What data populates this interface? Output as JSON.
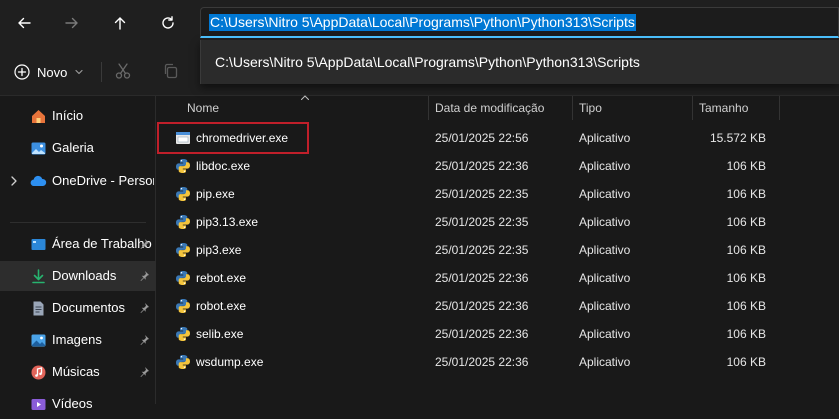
{
  "address": {
    "path": "C:\\Users\\Nitro 5\\AppData\\Local\\Programs\\Python\\Python313\\Scripts",
    "suggestion": "C:\\Users\\Nitro 5\\AppData\\Local\\Programs\\Python\\Python313\\Scripts"
  },
  "nav_buttons": {
    "back_icon": "arrow-left-icon",
    "forward_icon": "arrow-right-icon",
    "up_icon": "arrow-up-icon",
    "refresh_icon": "refresh-icon"
  },
  "command_bar": {
    "new_label": "Novo",
    "new_icon": "plus-icon",
    "cut_icon": "scissors-icon",
    "copy_icon": "copy-icon"
  },
  "sidebar": {
    "items": [
      {
        "label": "Início",
        "icon": "home-icon"
      },
      {
        "label": "Galeria",
        "icon": "gallery-icon"
      },
      {
        "label": "OneDrive - Persona",
        "icon": "cloud-icon"
      },
      {
        "label": "Área de Trabalho",
        "icon": "desktop-icon"
      },
      {
        "label": "Downloads",
        "icon": "download-icon"
      },
      {
        "label": "Documentos",
        "icon": "document-icon"
      },
      {
        "label": "Imagens",
        "icon": "image-icon"
      },
      {
        "label": "Músicas",
        "icon": "music-icon"
      },
      {
        "label": "Vídeos",
        "icon": "video-icon"
      }
    ]
  },
  "columns": {
    "name": "Nome",
    "date": "Data de modificação",
    "type": "Tipo",
    "size": "Tamanho"
  },
  "files": [
    {
      "name": "chromedriver.exe",
      "date": "25/01/2025 22:56",
      "type": "Aplicativo",
      "size": "15.572 KB",
      "icon": "app-window-icon"
    },
    {
      "name": "libdoc.exe",
      "date": "25/01/2025 22:36",
      "type": "Aplicativo",
      "size": "106 KB",
      "icon": "python-icon"
    },
    {
      "name": "pip.exe",
      "date": "25/01/2025 22:35",
      "type": "Aplicativo",
      "size": "106 KB",
      "icon": "python-icon"
    },
    {
      "name": "pip3.13.exe",
      "date": "25/01/2025 22:35",
      "type": "Aplicativo",
      "size": "106 KB",
      "icon": "python-icon"
    },
    {
      "name": "pip3.exe",
      "date": "25/01/2025 22:35",
      "type": "Aplicativo",
      "size": "106 KB",
      "icon": "python-icon"
    },
    {
      "name": "rebot.exe",
      "date": "25/01/2025 22:36",
      "type": "Aplicativo",
      "size": "106 KB",
      "icon": "python-icon"
    },
    {
      "name": "robot.exe",
      "date": "25/01/2025 22:36",
      "type": "Aplicativo",
      "size": "106 KB",
      "icon": "python-icon"
    },
    {
      "name": "selib.exe",
      "date": "25/01/2025 22:36",
      "type": "Aplicativo",
      "size": "106 KB",
      "icon": "python-icon"
    },
    {
      "name": "wsdump.exe",
      "date": "25/01/2025 22:36",
      "type": "Aplicativo",
      "size": "106 KB",
      "icon": "python-icon"
    }
  ],
  "colors": {
    "accent": "#4cc2ff",
    "selection": "#0078d4",
    "highlight_border": "#c01f2a"
  }
}
